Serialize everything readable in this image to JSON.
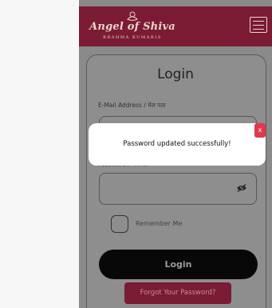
{
  "header": {
    "brand_title": "Angel of Shiva",
    "brand_subtitle": "BRAHMA KUMARIS",
    "menu_icon": "hamburger-menu-icon"
  },
  "login_form": {
    "title": "Login",
    "email_label": "E-Mail Address / मेल पता",
    "email_value": "",
    "password_label": "Password / पासवर्ड",
    "password_value": "",
    "password_toggle_icon": "eye-slash-icon",
    "remember_label": "Remember Me",
    "remember_checked": false,
    "login_button": "Login",
    "forgot_button": "Forgot Your Password?"
  },
  "toast": {
    "message": "Password updated successfully!",
    "close_label": "x"
  },
  "colors": {
    "brand": "#7b1b34",
    "toast_close": "#e0384f"
  }
}
